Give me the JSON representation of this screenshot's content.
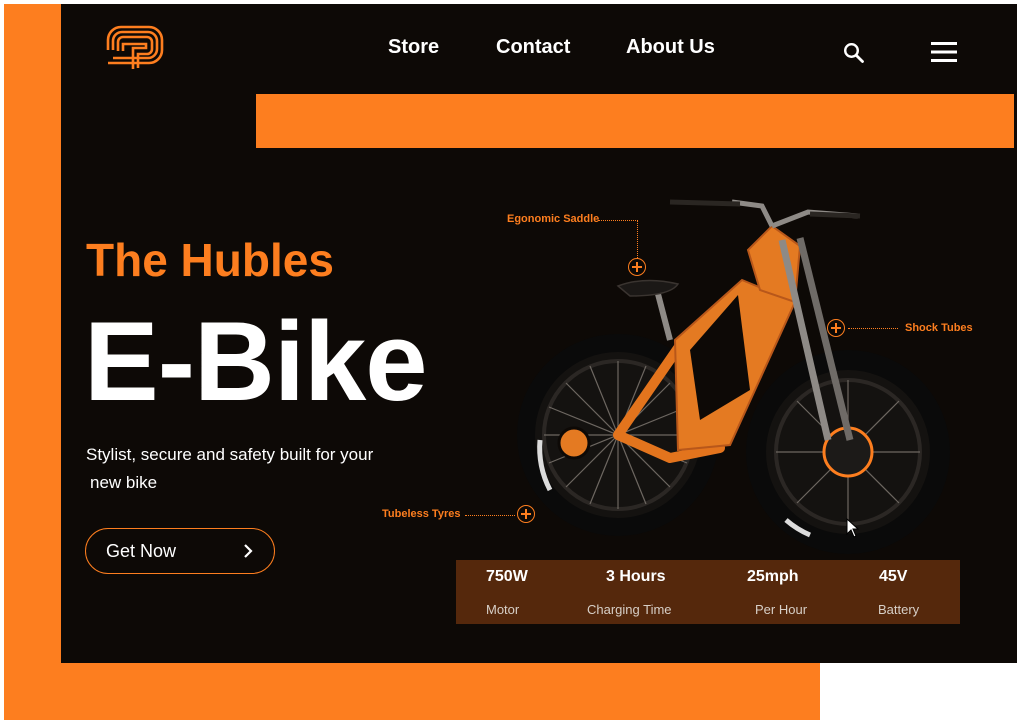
{
  "nav": {
    "links": [
      "Store",
      "Contact",
      "About Us"
    ]
  },
  "hero": {
    "subtitle": "The Hubles",
    "title": "E-Bike",
    "description_line1": "Stylist, secure and safety built for your",
    "description_line2": "new bike",
    "cta_label": "Get Now"
  },
  "callouts": {
    "saddle": "Egonomic Saddle",
    "shock": "Shock Tubes",
    "tyres": "Tubeless Tyres"
  },
  "specs": [
    {
      "value": "750W",
      "label": "Motor"
    },
    {
      "value": "3 Hours",
      "label": "Charging Time"
    },
    {
      "value": "25mph",
      "label": "Per Hour"
    },
    {
      "value": "45V",
      "label": "Battery"
    }
  ],
  "colors": {
    "accent": "#fd7e1f",
    "background": "#0d0906",
    "spec_panel": "#55280c"
  },
  "icons": [
    "logo-icon",
    "search-icon",
    "menu-icon",
    "chevron-right-icon",
    "plus-circle-icon"
  ]
}
